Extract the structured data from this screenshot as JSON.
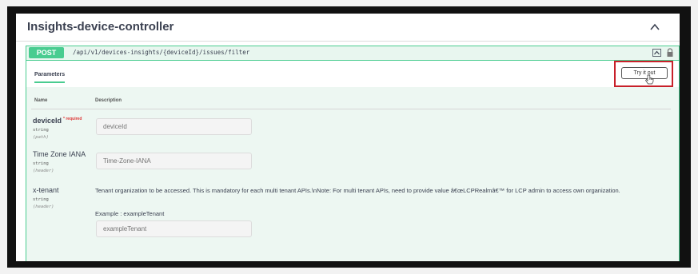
{
  "controller": {
    "title": "Insights-device-controller"
  },
  "operation": {
    "method": "POST",
    "path": "/api/v1/devices-insights/{deviceId}/issues/filter"
  },
  "params_section": {
    "tab_label": "Parameters",
    "try_button_label": "Try it out"
  },
  "columns": {
    "name": "Name",
    "description": "Description"
  },
  "params": [
    {
      "name": "deviceId",
      "required": "* required",
      "type": "string",
      "in": "(path)",
      "placeholder": "deviceId"
    },
    {
      "name": "Time Zone IANA",
      "type": "string",
      "in": "(header)",
      "placeholder": "Time-Zone-IANA"
    },
    {
      "name": "x-tenant",
      "type": "string",
      "in": "(header)",
      "description": "Tenant organization to be accessed. This is mandatory for each multi tenant APIs.\\nNote: For multi tenant APIs, need to provide value â€œLCPRealmâ€™ for LCP admin to access own organization.",
      "example": "Example : exampleTenant",
      "placeholder": "exampleTenant"
    }
  ],
  "icons": {
    "collapse": "chevron-up-icon",
    "summary_toggle": "chevron-up-icon",
    "lock": "lock-icon",
    "cursor": "hand-cursor-icon"
  },
  "colors": {
    "post_green": "#49cc90",
    "highlight_red": "#c8202a",
    "title_text": "#3b4151"
  }
}
